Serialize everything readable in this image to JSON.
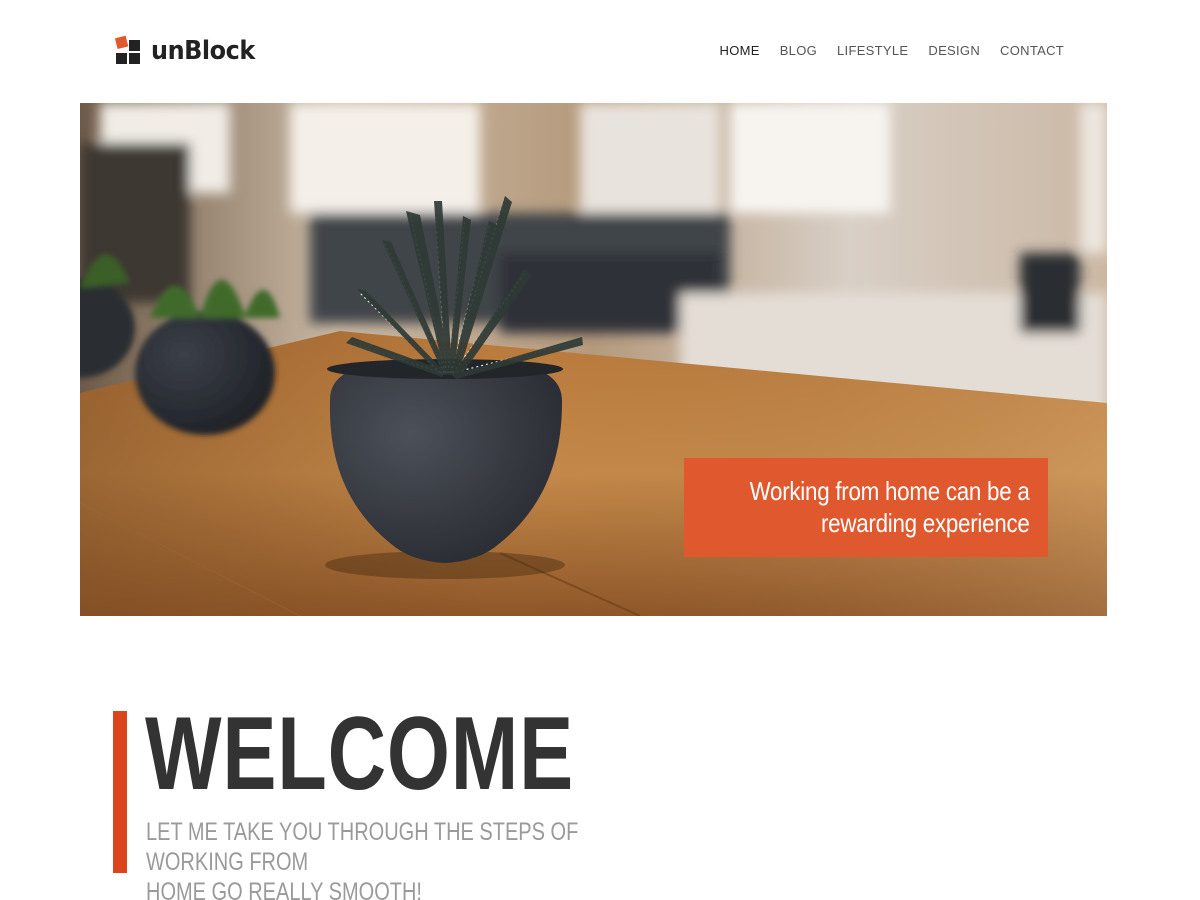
{
  "header": {
    "logo_text": "unBlock",
    "logo_icon": "blocks-logo-icon",
    "nav": [
      {
        "label": "HOME",
        "active": true
      },
      {
        "label": "BLOG",
        "active": false
      },
      {
        "label": "LIFESTYLE",
        "active": false
      },
      {
        "label": "DESIGN",
        "active": false
      },
      {
        "label": "CONTACT",
        "active": false
      }
    ]
  },
  "hero": {
    "image_subject": "potted succulent on wooden table",
    "caption_line1": "Working from home can be a",
    "caption_line2": "rewarding experience"
  },
  "welcome": {
    "title": "WELCOME",
    "subtitle_line1": "LET ME TAKE YOU THROUGH THE STEPS OF WORKING FROM",
    "subtitle_line2": "HOME GO REALLY SMOOTH!"
  },
  "colors": {
    "accent": "#e0582e",
    "accent_bar": "#d9441c",
    "heading": "#333333",
    "subtext": "#9a9a9a"
  }
}
